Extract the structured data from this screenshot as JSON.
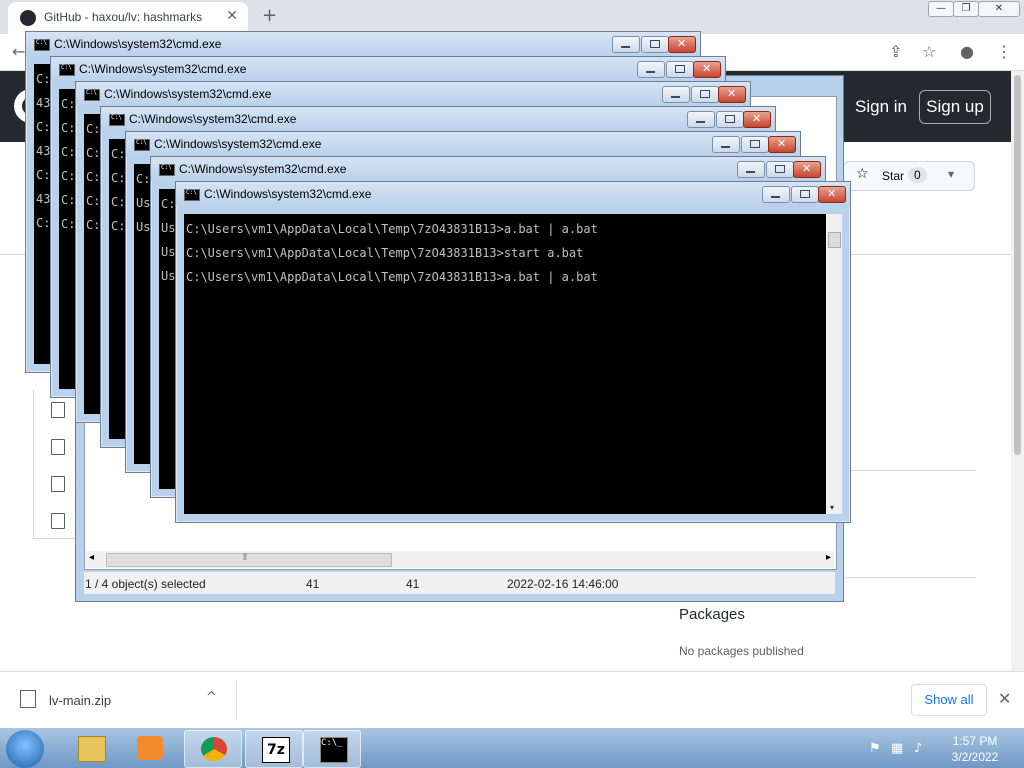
{
  "browser": {
    "tab_title": "GitHub - haxou/lv: hashmarks",
    "new_tab": "+",
    "tab_close": "✕",
    "min_glyph": "—",
    "max_glyph": "❐",
    "close_glyph": "✕",
    "nav": {
      "back": "←",
      "share": "⇪",
      "bookmark": "☆",
      "profile": "●",
      "menu": "⋮"
    }
  },
  "github": {
    "signin": "Sign in",
    "signup": "Sign up",
    "star_label": "Star",
    "star_count": "0",
    "star_dropdown": "▾",
    "packages_title": "Packages",
    "packages_empty": "No packages published"
  },
  "zip_window": {
    "status": {
      "selection": "1 / 4 object(s) selected",
      "size": "41",
      "packed": "41",
      "modified": "2022-02-16 14:46:00"
    },
    "scroll_left": "◂",
    "scroll_right": "▸",
    "scroll_grip": "⦀"
  },
  "cmd_windows": {
    "title": "C:\\Windows\\system32\\cmd.exe",
    "front_lines": [
      "C:\\Users\\vm1\\AppData\\Local\\Temp\\7zO43831B13>a.bat | a.bat",
      "C:\\Users\\vm1\\AppData\\Local\\Temp\\7zO43831B13>start a.bat",
      "C:\\Users\\vm1\\AppData\\Local\\Temp\\7zO43831B13>a.bat | a.bat"
    ],
    "partial_lines": [
      [
        "C:",
        "43",
        "C:",
        "43",
        "C:",
        "43",
        "C:"
      ],
      [
        "C:",
        "C:",
        "C:",
        "C:",
        "C:",
        "C:"
      ],
      [
        "C:",
        "C:",
        "C:",
        "C:",
        "C:"
      ],
      [
        "C:",
        "C:",
        "C:",
        "C:"
      ],
      [
        "C:",
        "Us",
        "Us"
      ],
      [
        "C:",
        "Us",
        "Us",
        "Us"
      ]
    ],
    "scroll_down": "▾"
  },
  "downloads": {
    "file_name": "lv-main.zip",
    "chevron": "^",
    "show_all": "Show all",
    "close": "✕"
  },
  "taskbar": {
    "time": "1:57 PM",
    "date": "3/2/2022",
    "apps": [
      "windows-explorer",
      "media-player",
      "chrome",
      "7-zip",
      "command-prompt"
    ],
    "seven_zip_label": "7z",
    "cmd_label": "C:\\_"
  },
  "colors": {
    "github_header": "#24292f",
    "window_frame": "#b9d1ea",
    "close_button": "#c7452e",
    "taskbar": "#6f98c4",
    "link_blue": "#1a73e8"
  }
}
